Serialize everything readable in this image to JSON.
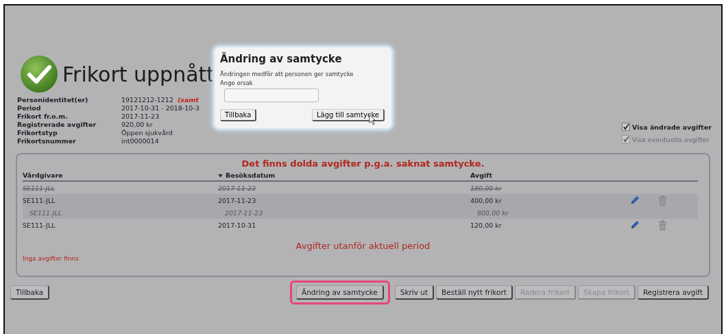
{
  "header": {
    "title": "Frikort uppnått"
  },
  "info": [
    {
      "label": "Personidentitet(er)",
      "value": "19121212-1212",
      "note": "(samt"
    },
    {
      "label": "Period",
      "value": "2017-10-31 - 2018-10-3"
    },
    {
      "label": "Frikort fr.o.m.",
      "value": "2017-11-23"
    },
    {
      "label": "Registrerade avgifter",
      "value": "920,00 kr"
    },
    {
      "label": "Frikortstyp",
      "value": "Öppen sjukvård"
    },
    {
      "label": "Frikortsnummer",
      "value": "int0000014"
    }
  ],
  "options": [
    {
      "label": "Visa ändrade avgifter",
      "checked": true,
      "disabled": false
    },
    {
      "label": "Visa eventuella avgifter",
      "checked": true,
      "disabled": true
    }
  ],
  "table": {
    "notice": "Det finns dolda avgifter p.g.a. saknat samtycke.",
    "columns": [
      {
        "label": "Vårdgivare",
        "sorted": false
      },
      {
        "label": "Besöksdatum",
        "sorted": true
      },
      {
        "label": "Avgift",
        "sorted": false
      }
    ],
    "rows": [
      {
        "kind": "removed",
        "selected": false,
        "cells": [
          "SE111-JLL",
          "2017-11-23",
          "180,00 kr"
        ]
      },
      {
        "kind": "normal",
        "selected": true,
        "cells": [
          "SE111-JLL",
          "2017-11-23",
          "400,00 kr"
        ],
        "children": [
          {
            "kind": "previous",
            "selected": true,
            "cells": [
              "SE111-JLL",
              "2017-11-23",
              "800,00 kr"
            ]
          }
        ]
      },
      {
        "kind": "normal",
        "selected": false,
        "cells": [
          "SE111-JLL",
          "2017-10-31",
          "120,00 kr"
        ]
      }
    ],
    "outside_period": "Avgifter utanför aktuell period",
    "empty_note": "Inga avgifter finns"
  },
  "back_button": {
    "label": "Tillbaka"
  },
  "actions": [
    {
      "label": "Ändring av samtycke",
      "disabled": false,
      "highlighted": true
    },
    {
      "label": "Skriv ut",
      "disabled": false,
      "highlighted": false
    },
    {
      "label": "Beställ nytt frikort",
      "disabled": false,
      "highlighted": false
    },
    {
      "label": "Radera frikort",
      "disabled": true,
      "highlighted": false
    },
    {
      "label": "Skapa frikort",
      "disabled": true,
      "highlighted": false
    },
    {
      "label": "Registrera avgift",
      "disabled": false,
      "highlighted": false
    }
  ],
  "dialog": {
    "title": "Ändring av samtycke",
    "message": "Ändringen medför att personen ger samtycke",
    "field_label": "Ange orsak",
    "buttons": [
      {
        "label": "Tillbaka"
      },
      {
        "label": "Lägg till samtycke"
      }
    ]
  }
}
